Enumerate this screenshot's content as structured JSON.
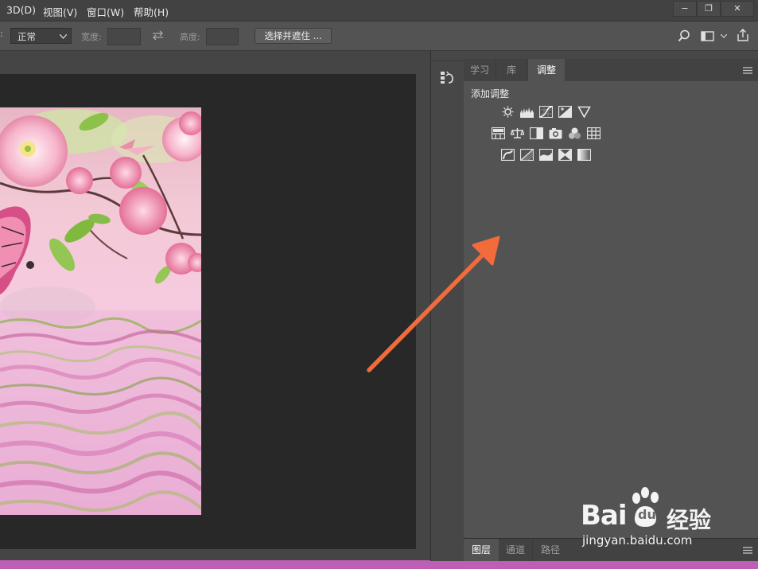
{
  "menu": {
    "items": [
      "3D(D)",
      "视图(V)",
      "窗口(W)",
      "帮助(H)"
    ]
  },
  "window_controls": {
    "minimize": "−",
    "restore": "❐",
    "close": "✕"
  },
  "options": {
    "mode_value": "正常",
    "width_label": "宽度:",
    "height_label": "高度:",
    "select_mask_button": "选择并遮住 ..."
  },
  "panel": {
    "tabs": [
      "学习",
      "库",
      "调整"
    ],
    "active_tab": "调整",
    "adjustments_title": "添加调整",
    "icons_row1": [
      "brightness-contrast-icon",
      "levels-icon",
      "curves-icon",
      "exposure-icon",
      "vibrance-icon"
    ],
    "icons_row2": [
      "hue-saturation-icon",
      "color-balance-icon",
      "black-white-icon",
      "photo-filter-icon",
      "channel-mixer-icon",
      "color-lookup-icon"
    ],
    "icons_row3": [
      "invert-icon",
      "posterize-icon",
      "threshold-icon",
      "selective-color-icon",
      "gradient-map-icon"
    ]
  },
  "layers_bar": {
    "tabs": [
      "图层",
      "通道",
      "路径"
    ],
    "active_tab": "图层"
  },
  "watermark": {
    "brand": "Bai",
    "brand2": "du",
    "product": "经验",
    "url": "jingyan.baidu.com"
  },
  "colors": {
    "accent_arrow": "#f26b3a",
    "status_bar": "#bc5fb5"
  }
}
